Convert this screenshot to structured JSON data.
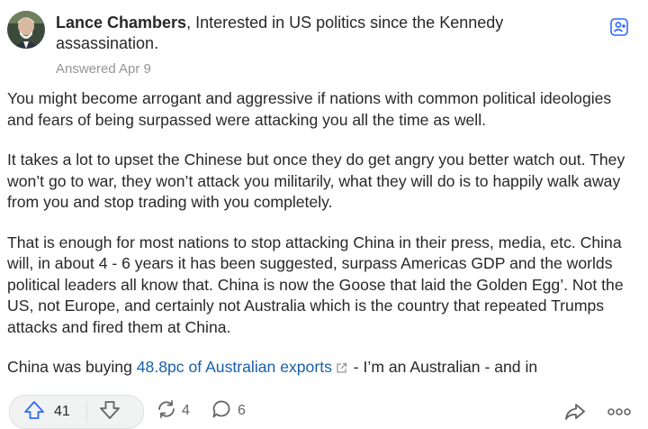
{
  "author": {
    "name": "Lance Chambers",
    "credential": ", Interested in US politics since the Kennedy assassination.",
    "answered": "Answered Apr 9"
  },
  "paragraphs": [
    "You might become arrogant and aggressive if nations with common political ideologies and fears of being surpassed were attacking you all the time as well.",
    "It takes a lot to upset the Chinese but once they do get angry you better watch out. They won’t go to war, they won’t attack you militarily, what they will do is to happily walk away from you and stop trading with you completely.",
    "That is enough for most nations to stop attacking China in their press, media, etc. China will, in about 4 - 6 years it has been suggested, surpass Americas GDP and the worlds political leaders all know that. China is now the Goose that laid the Golden Egg’. Not the US, not Europe, and certainly not Australia which is the country that repeated Trumps attacks and fired them at China."
  ],
  "last_paragraph": {
    "before": "China was buying ",
    "link": "48.8pc of Australian exports",
    "after": " - I’m an Australian - and in"
  },
  "actions": {
    "upvotes": "41",
    "shares": "4",
    "comments": "6"
  },
  "icons": {
    "upvote": "upvote-arrow-icon",
    "downvote": "downvote-arrow-icon",
    "share": "reshare-icon",
    "comment": "comment-bubble-icon",
    "forward": "share-forward-icon",
    "more": "more-dots-icon",
    "follow": "follow-user-icon"
  },
  "colors": {
    "link": "#195faa",
    "upvote": "#2e69ff",
    "text": "#282829",
    "muted": "#939598"
  }
}
